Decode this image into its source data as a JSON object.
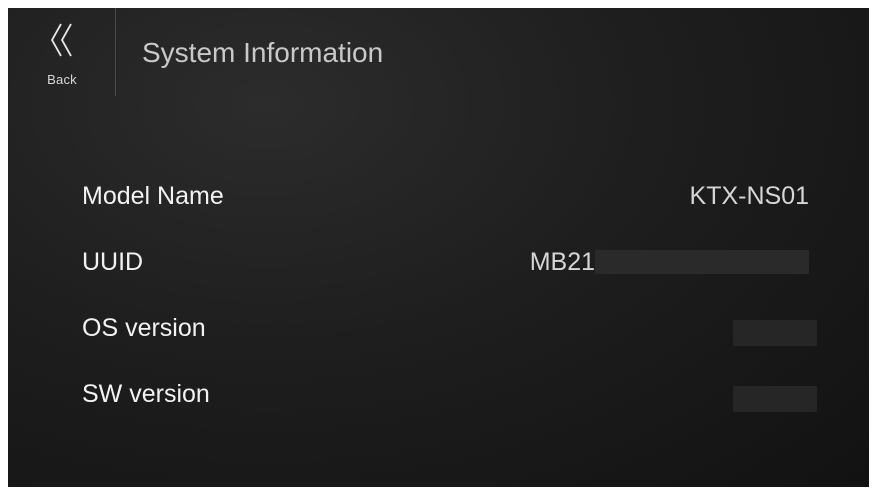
{
  "header": {
    "back_label": "Back",
    "back_icon": "double-chevron-left-icon",
    "title": "System Information"
  },
  "info": {
    "model_name": {
      "label": "Model Name",
      "value": "KTX-NS01"
    },
    "uuid": {
      "label": "UUID",
      "value_prefix": "MB21",
      "redacted": true
    },
    "os_version": {
      "label": "OS version",
      "redacted": true
    },
    "sw_version": {
      "label": "SW version",
      "redacted": true
    }
  },
  "colors": {
    "background": "#1e1e1e",
    "text_primary": "#f2f2f2",
    "text_secondary": "#c9c9c9",
    "redaction": "#2a2a2a"
  }
}
